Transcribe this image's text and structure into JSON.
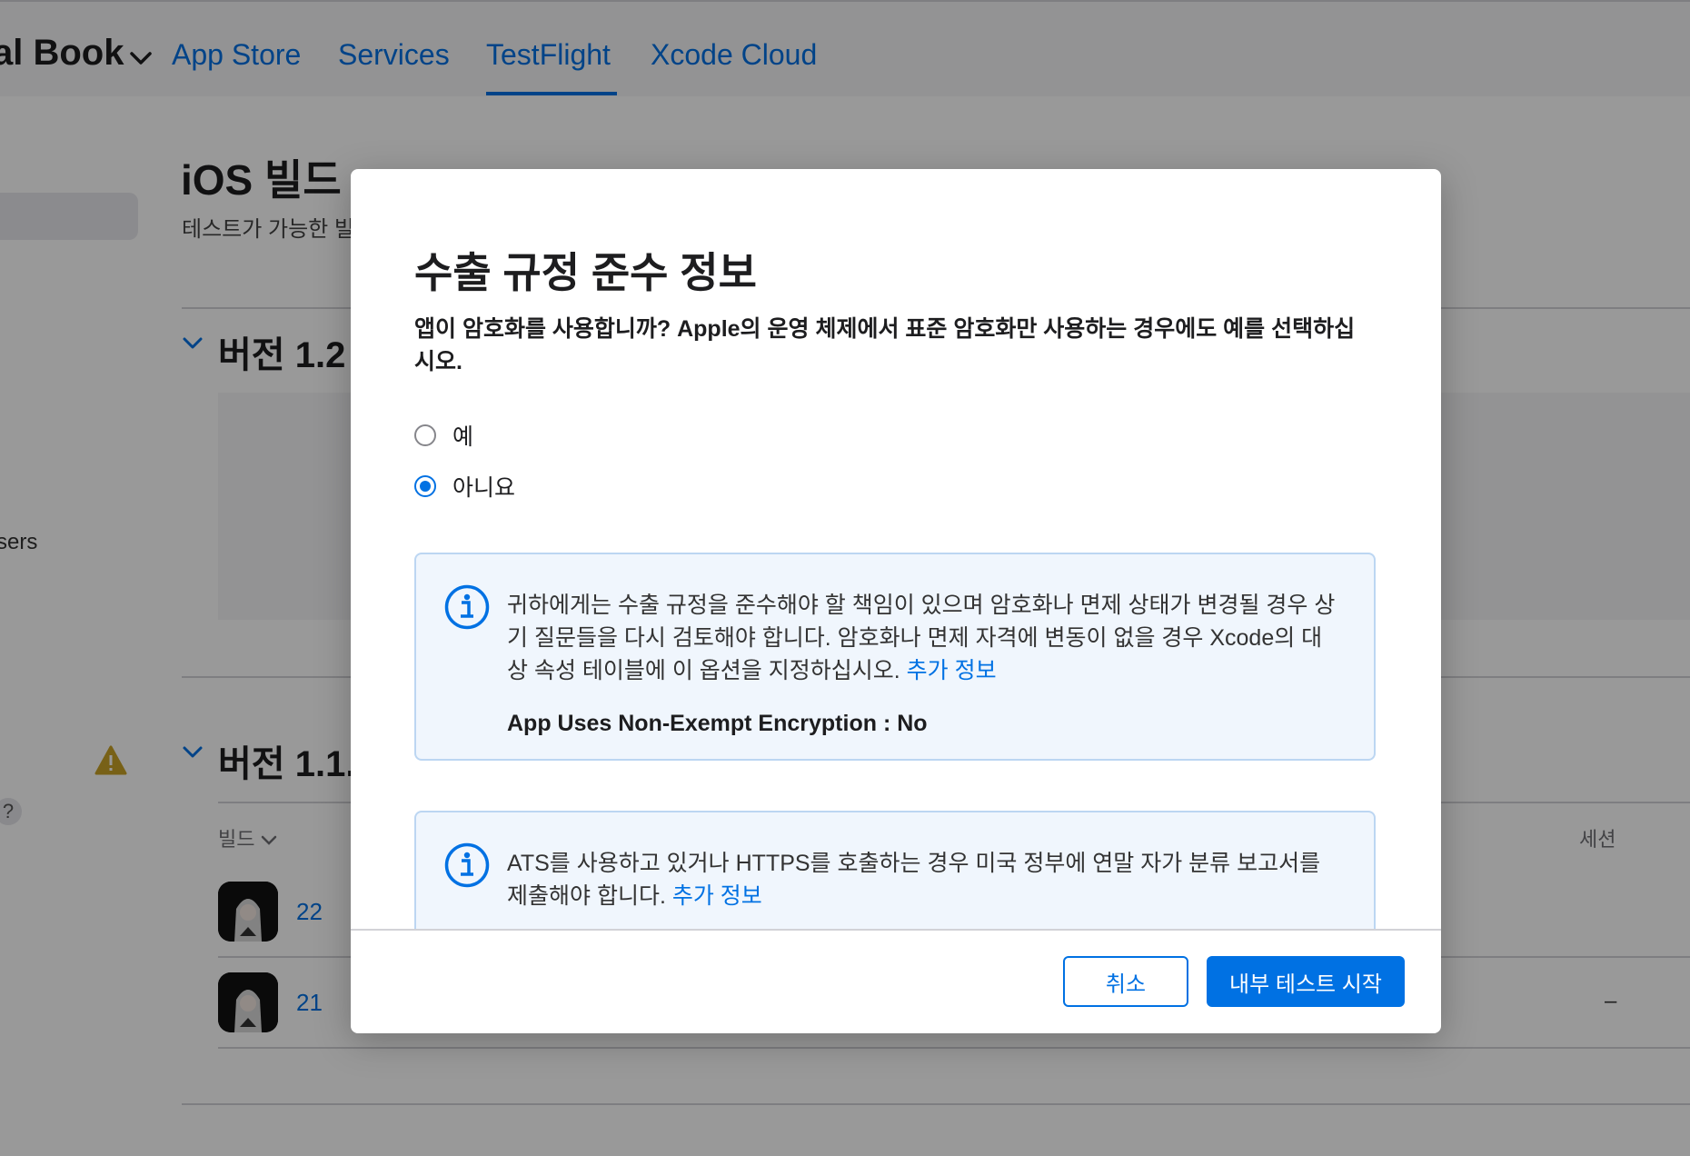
{
  "nav": {
    "brand": "al Book",
    "items": [
      {
        "label": "App Store"
      },
      {
        "label": "Services"
      },
      {
        "label": "TestFlight"
      },
      {
        "label": "Xcode Cloud"
      }
    ],
    "active": "TestFlight"
  },
  "sidebar": {
    "partial_users": "sers",
    "partial_help": "?"
  },
  "page": {
    "title": "iOS 빌드",
    "subtitle": "테스트가 가능한 빌",
    "versions": [
      {
        "label": "버전 1.2"
      },
      {
        "label": "버전 1.1."
      }
    ],
    "table": {
      "build_column": "빌드",
      "session_column": "세션",
      "rows": [
        {
          "build": "22",
          "session": ""
        },
        {
          "build": "21",
          "session": "–"
        }
      ]
    }
  },
  "modal": {
    "title": "수출 규정 준수 정보",
    "question": "앱이 암호화를 사용합니까? Apple의 운영 체제에서 표준 암호화만 사용하는 경우에도 예를 선택하십시오.",
    "options": [
      {
        "label": "예",
        "selected": false
      },
      {
        "label": "아니요",
        "selected": true
      }
    ],
    "info1": {
      "text": "귀하에게는 수출 규정을 준수해야 할 책임이 있으며 암호화나 면제 상태가 변경될 경우 상기 질문들을 다시 검토해야 합니다. 암호화나 면제 자격에 변동이 없을 경우 Xcode의 대상 속성 테이블에 이 옵션을 지정하십시오.",
      "link": "추가 정보",
      "code": "App Uses Non-Exempt Encryption : No"
    },
    "info2": {
      "text": "ATS를 사용하고 있거나 HTTPS를 호출하는 경우 미국 정부에 연말 자가 분류 보고서를 제출해야 합니다.",
      "link": "추가 정보"
    },
    "cancel_label": "취소",
    "confirm_label": "내부 테스트 시작"
  },
  "colors": {
    "accent": "#0071e3",
    "info_bg": "#f0f6fd",
    "info_border": "#bcd6f2",
    "warning": "#c9a227"
  }
}
